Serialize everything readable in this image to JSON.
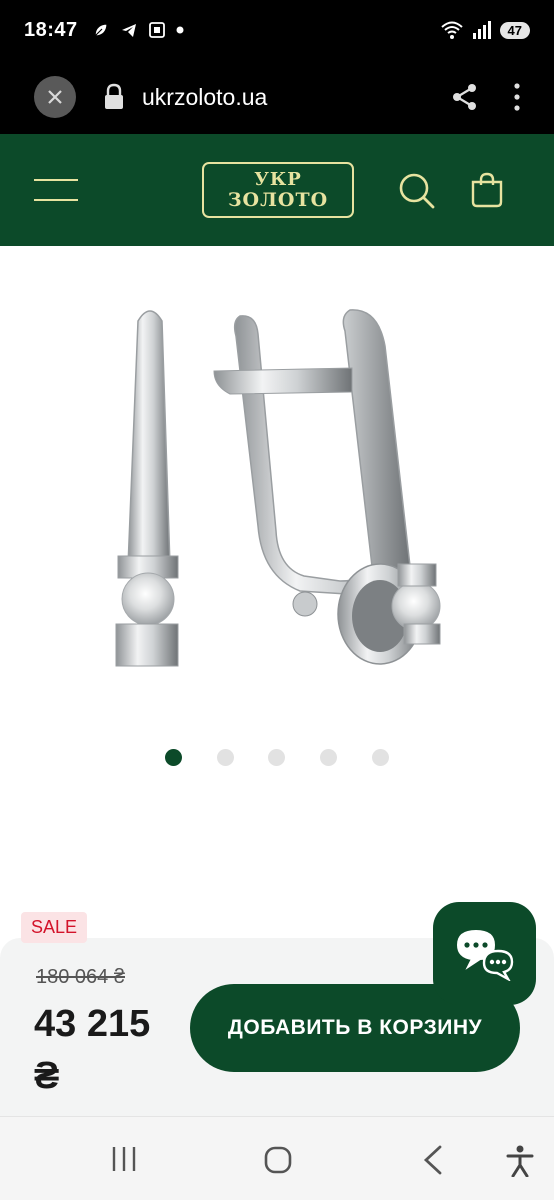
{
  "status_bar": {
    "time": "18:47",
    "battery": "47",
    "notification_icons": [
      "leaf-icon",
      "telegram-icon",
      "screenshot-icon",
      "dot-icon"
    ]
  },
  "browser": {
    "url": "ukrzoloto.ua"
  },
  "header": {
    "logo_line1": "УКР",
    "logo_line2": "ЗОЛОТО",
    "brand_color": "#0c4a29",
    "accent_color": "#e7e3a0"
  },
  "gallery": {
    "total_slides": 5,
    "active_slide": 1
  },
  "product": {
    "sale_badge": "SALE",
    "old_price": "180 064 ₴",
    "price": "43 215 ₴",
    "add_to_cart_label": "ДОБАВИТЬ В КОРЗИНУ"
  },
  "colors": {
    "sale": "#d3132a",
    "button": "#0c4a29"
  }
}
